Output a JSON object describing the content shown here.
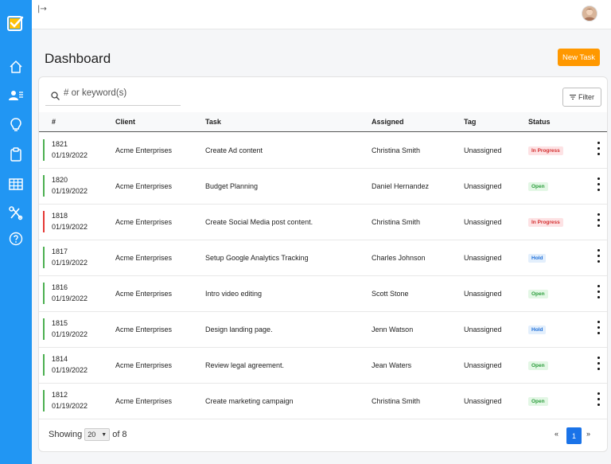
{
  "nav": {
    "items": [
      "home-icon",
      "users-icon",
      "lightbulb-icon",
      "clipboard-icon",
      "table-icon",
      "tools-icon",
      "help-icon"
    ]
  },
  "header": {
    "title": "Dashboard",
    "new_task_label": "New Task"
  },
  "search": {
    "placeholder": "# or keyword(s)"
  },
  "filter_label": "Filter",
  "table": {
    "columns": [
      "#",
      "Client",
      "Task",
      "Assigned",
      "Tag",
      "Status"
    ],
    "rows": [
      {
        "id": "1821",
        "date": "01/19/2022",
        "client": "Acme Enterprises",
        "task": "Create Ad content",
        "assigned": "Christina Smith",
        "tag": "Unassigned",
        "status": "In Progress",
        "marker_color": "#4caf50"
      },
      {
        "id": "1820",
        "date": "01/19/2022",
        "client": "Acme Enterprises",
        "task": "Budget Planning",
        "assigned": "Daniel Hernandez",
        "tag": "Unassigned",
        "status": "Open",
        "marker_color": "#4caf50"
      },
      {
        "id": "1818",
        "date": "01/19/2022",
        "client": "Acme Enterprises",
        "task": "Create Social Media post content.",
        "assigned": "Christina Smith",
        "tag": "Unassigned",
        "status": "In Progress",
        "marker_color": "#e53935"
      },
      {
        "id": "1817",
        "date": "01/19/2022",
        "client": "Acme Enterprises",
        "task": "Setup Google Analytics Tracking",
        "assigned": "Charles Johnson",
        "tag": "Unassigned",
        "status": "Hold",
        "marker_color": "#4caf50"
      },
      {
        "id": "1816",
        "date": "01/19/2022",
        "client": "Acme Enterprises",
        "task": "Intro video editing",
        "assigned": "Scott Stone",
        "tag": "Unassigned",
        "status": "Open",
        "marker_color": "#4caf50"
      },
      {
        "id": "1815",
        "date": "01/19/2022",
        "client": "Acme Enterprises",
        "task": "Design landing page.",
        "assigned": "Jenn Watson",
        "tag": "Unassigned",
        "status": "Hold",
        "marker_color": "#4caf50"
      },
      {
        "id": "1814",
        "date": "01/19/2022",
        "client": "Acme Enterprises",
        "task": "Review legal agreement.",
        "assigned": "Jean Waters",
        "tag": "Unassigned",
        "status": "Open",
        "marker_color": "#4caf50"
      },
      {
        "id": "1812",
        "date": "01/19/2022",
        "client": "Acme Enterprises",
        "task": "Create marketing campaign",
        "assigned": "Christina Smith",
        "tag": "Unassigned",
        "status": "Open",
        "marker_color": "#4caf50"
      }
    ]
  },
  "status_colors": {
    "In Progress": {
      "bg": "#fde2e4",
      "fg": "#d32f2f"
    },
    "Open": {
      "bg": "#e3f7e5",
      "fg": "#2e9e3e"
    },
    "Hold": {
      "bg": "#e3effc",
      "fg": "#1e6fd9"
    }
  },
  "footer": {
    "showing_label": "Showing",
    "page_size": "20",
    "of_label": "of 8",
    "prev": "«",
    "current_page": "1",
    "next": "»"
  }
}
